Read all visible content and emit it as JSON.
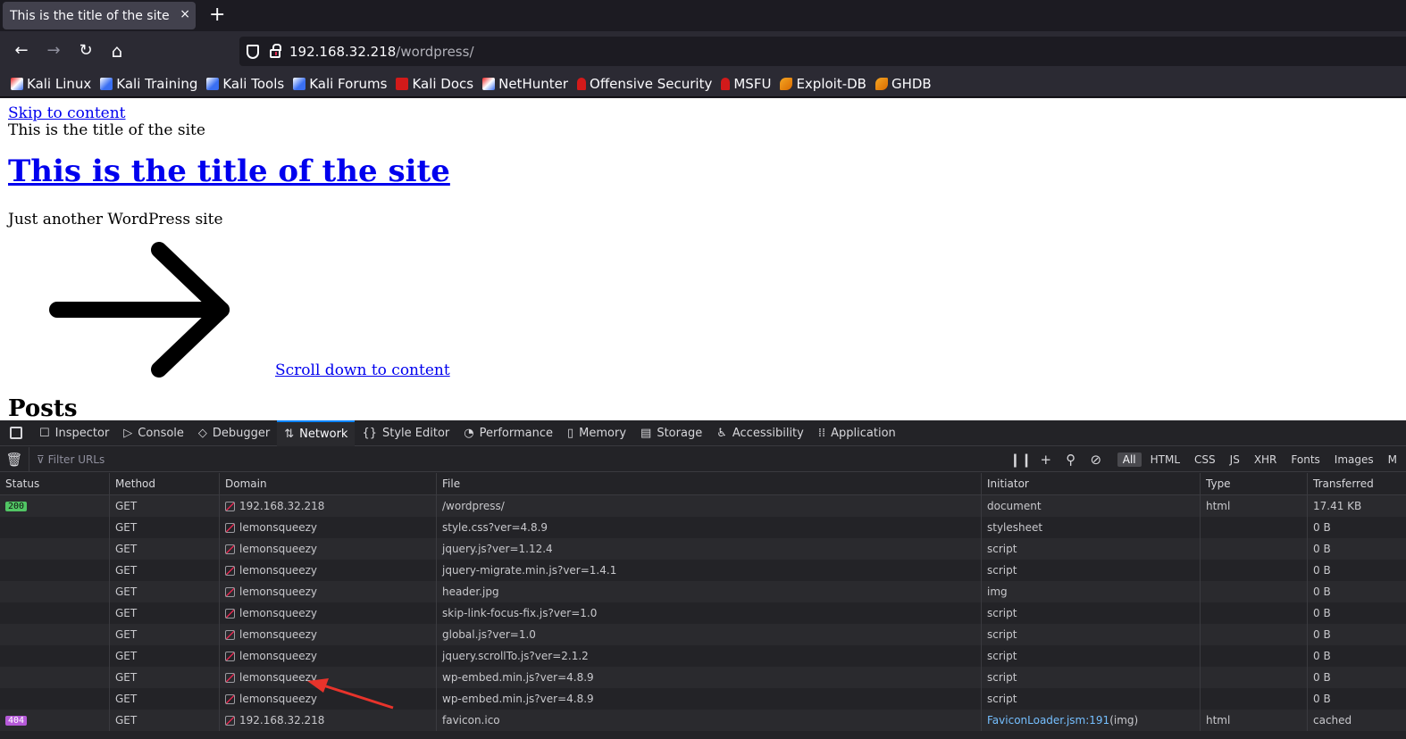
{
  "tab": {
    "title": "This is the title of the site — J",
    "close": "×",
    "new": "+"
  },
  "nav": {
    "back": "←",
    "forward": "→",
    "reload": "↻",
    "home": "⌂",
    "url_host": "192.168.32.218",
    "url_path": "/wordpress/"
  },
  "bookmarks": [
    {
      "label": "Kali Linux",
      "icon": "kali-dragon-icon"
    },
    {
      "label": "Kali Training",
      "icon": "kali-blue-icon"
    },
    {
      "label": "Kali Tools",
      "icon": "kali-blue-icon"
    },
    {
      "label": "Kali Forums",
      "icon": "kali-blue-icon"
    },
    {
      "label": "Kali Docs",
      "icon": "kali-docs-icon"
    },
    {
      "label": "NetHunter",
      "icon": "kali-dragon-icon"
    },
    {
      "label": "Offensive Security",
      "icon": "offsec-icon"
    },
    {
      "label": "MSFU",
      "icon": "offsec-icon"
    },
    {
      "label": "Exploit-DB",
      "icon": "exploitdb-icon"
    },
    {
      "label": "GHDB",
      "icon": "exploitdb-icon"
    }
  ],
  "page": {
    "skip_link": "Skip to content",
    "site_title_small": "This is the title of the site",
    "site_title_h1": "This is the title of the site",
    "tagline": "Just another WordPress site",
    "scroll_link": "Scroll down to content",
    "posts_heading": "Posts"
  },
  "devtools": {
    "tabs": [
      {
        "label": "Inspector",
        "icon": "☐"
      },
      {
        "label": "Console",
        "icon": "▷"
      },
      {
        "label": "Debugger",
        "icon": "◇"
      },
      {
        "label": "Network",
        "icon": "⇅"
      },
      {
        "label": "Style Editor",
        "icon": "{}"
      },
      {
        "label": "Performance",
        "icon": "◔"
      },
      {
        "label": "Memory",
        "icon": "▯"
      },
      {
        "label": "Storage",
        "icon": "▤"
      },
      {
        "label": "Accessibility",
        "icon": "♿"
      },
      {
        "label": "Application",
        "icon": "⁞⁞"
      }
    ],
    "active_tab": "Network",
    "filter_placeholder": "Filter URLs",
    "type_filters": [
      "All",
      "HTML",
      "CSS",
      "JS",
      "XHR",
      "Fonts",
      "Images",
      "M"
    ],
    "columns": [
      "Status",
      "Method",
      "Domain",
      "File",
      "Initiator",
      "Type",
      "Transferred"
    ],
    "rows": [
      {
        "status": "200",
        "method": "GET",
        "domain": "192.168.32.218",
        "file": "/wordpress/",
        "initiator": "document",
        "type": "html",
        "transferred": "17.41 KB"
      },
      {
        "status": "",
        "method": "GET",
        "domain": "lemonsqueezy",
        "file": "style.css?ver=4.8.9",
        "initiator": "stylesheet",
        "type": "",
        "transferred": "0 B"
      },
      {
        "status": "",
        "method": "GET",
        "domain": "lemonsqueezy",
        "file": "jquery.js?ver=1.12.4",
        "initiator": "script",
        "type": "",
        "transferred": "0 B"
      },
      {
        "status": "",
        "method": "GET",
        "domain": "lemonsqueezy",
        "file": "jquery-migrate.min.js?ver=1.4.1",
        "initiator": "script",
        "type": "",
        "transferred": "0 B"
      },
      {
        "status": "",
        "method": "GET",
        "domain": "lemonsqueezy",
        "file": "header.jpg",
        "initiator": "img",
        "type": "",
        "transferred": "0 B"
      },
      {
        "status": "",
        "method": "GET",
        "domain": "lemonsqueezy",
        "file": "skip-link-focus-fix.js?ver=1.0",
        "initiator": "script",
        "type": "",
        "transferred": "0 B"
      },
      {
        "status": "",
        "method": "GET",
        "domain": "lemonsqueezy",
        "file": "global.js?ver=1.0",
        "initiator": "script",
        "type": "",
        "transferred": "0 B"
      },
      {
        "status": "",
        "method": "GET",
        "domain": "lemonsqueezy",
        "file": "jquery.scrollTo.js?ver=2.1.2",
        "initiator": "script",
        "type": "",
        "transferred": "0 B"
      },
      {
        "status": "",
        "method": "GET",
        "domain": "lemonsqueezy",
        "file": "wp-embed.min.js?ver=4.8.9",
        "initiator": "script",
        "type": "",
        "transferred": "0 B"
      },
      {
        "status": "",
        "method": "GET",
        "domain": "lemonsqueezy",
        "file": "wp-embed.min.js?ver=4.8.9",
        "initiator": "script",
        "type": "",
        "transferred": "0 B"
      },
      {
        "status": "404",
        "method": "GET",
        "domain": "192.168.32.218",
        "file": "favicon.ico",
        "initiator": "FaviconLoader.jsm:191",
        "initiator_suffix": " (img)",
        "type": "html",
        "transferred": "cached"
      }
    ]
  },
  "colors": {
    "accent": "#0a84ff",
    "status_ok": "#51c564",
    "status_404": "#b65ad9",
    "link": "#0000ee",
    "annotation": "#e8332b"
  }
}
